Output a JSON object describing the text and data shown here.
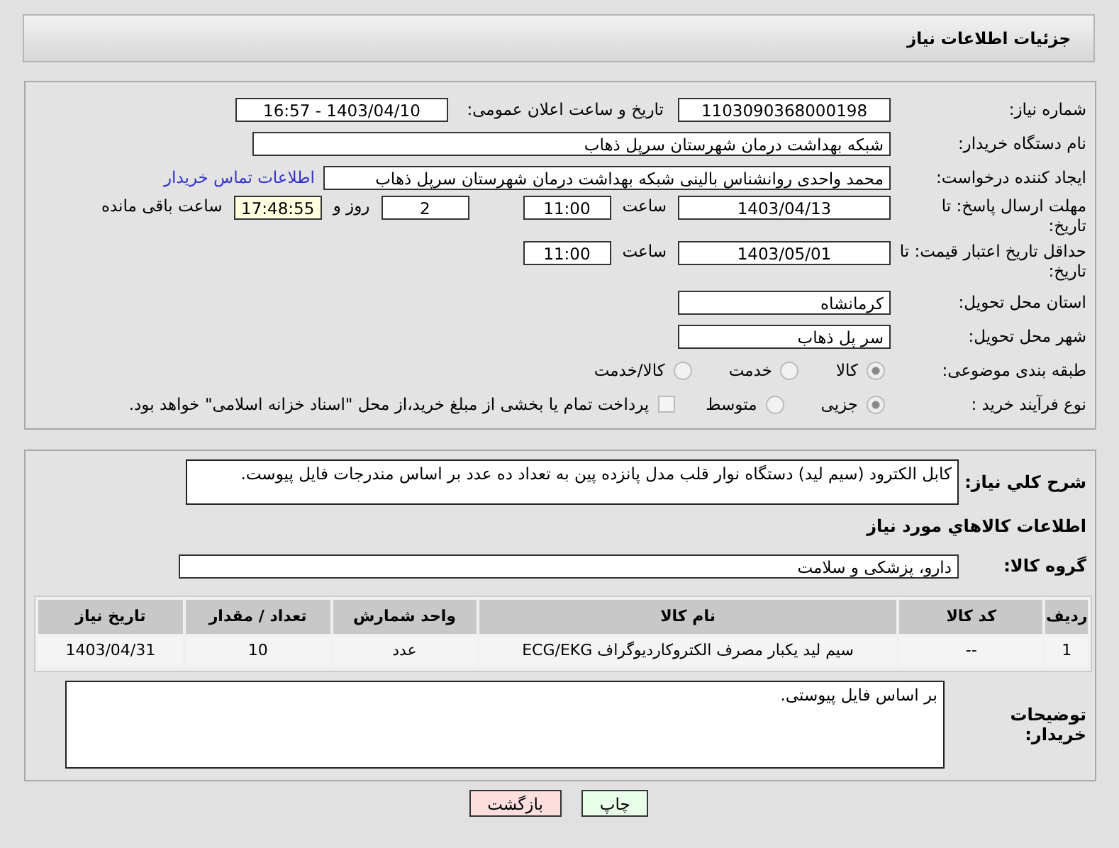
{
  "header": {
    "title": "جزئیات اطلاعات نیاز"
  },
  "details": {
    "need_number": {
      "label": "شماره نیاز:",
      "value": "1103090368000198"
    },
    "announce": {
      "label": "تاریخ و ساعت اعلان عمومی:",
      "value": "1403/04/10 - 16:57"
    },
    "buyer_org": {
      "label": "نام دستگاه خریدار:",
      "value": "شبکه بهداشت درمان شهرستان سرپل ذهاب"
    },
    "requester": {
      "label": "ایجاد کننده درخواست:",
      "value": "محمد واحدی روانشناس بالینی شبکه بهداشت درمان شهرستان سرپل ذهاب",
      "link": "اطلاعات تماس خریدار"
    },
    "reply_deadline": {
      "label": "مهلت ارسال پاسخ: تا تاریخ:",
      "date": "1403/04/13",
      "time_label": "ساعت",
      "time": "11:00",
      "days": "2",
      "days_label": "روز و",
      "remaining": "17:48:55",
      "remaining_label": "ساعت باقی مانده"
    },
    "price_validity": {
      "label": "حداقل تاریخ اعتبار قیمت: تا تاریخ:",
      "date": "1403/05/01",
      "time_label": "ساعت",
      "time": "11:00"
    },
    "province": {
      "label": "استان محل تحویل:",
      "value": "کرمانشاه"
    },
    "city": {
      "label": "شهر محل تحویل:",
      "value": "سر پل ذهاب"
    },
    "category": {
      "label": "طبقه بندی موضوعی:",
      "options": [
        {
          "label": "کالا",
          "selected": true
        },
        {
          "label": "خدمت",
          "selected": false
        },
        {
          "label": "کالا/خدمت",
          "selected": false
        }
      ]
    },
    "process": {
      "label": "نوع فرآیند خرید :",
      "options": [
        {
          "label": "جزیی",
          "selected": true
        },
        {
          "label": "متوسط",
          "selected": false
        }
      ],
      "payment": {
        "label": "پرداخت تمام یا بخشی از مبلغ خرید،از محل \"اسناد خزانه اسلامی\" خواهد بود.",
        "checked": false
      }
    }
  },
  "need": {
    "description": {
      "label": "شرح کلي نياز:",
      "value": "کابل الکترود (سیم لید) دستگاه نوار قلب مدل پانزده پین به تعداد ده عدد بر اساس مندرجات فایل پیوست."
    },
    "items_heading": "اطلاعات کالاهاي مورد نياز",
    "group": {
      "label": "گروه کالا:",
      "value": "دارو، پزشکی و سلامت"
    },
    "table": {
      "columns": [
        "ردیف",
        "کد کالا",
        "نام کالا",
        "واحد شمارش",
        "تعداد / مقدار",
        "تاریخ نیاز"
      ],
      "rows": [
        [
          "1",
          "--",
          "سیم لید یکبار مصرف الکتروکاردیوگراف ECG/EKG",
          "عدد",
          "10",
          "1403/04/31"
        ]
      ]
    },
    "buyer_notes": {
      "label": "توضیحات خریدار:",
      "value": "بر اساس فایل پیوستی."
    }
  },
  "buttons": [
    {
      "label": "چاپ",
      "kind": "print"
    },
    {
      "label": "بازگشت",
      "kind": "back"
    }
  ]
}
